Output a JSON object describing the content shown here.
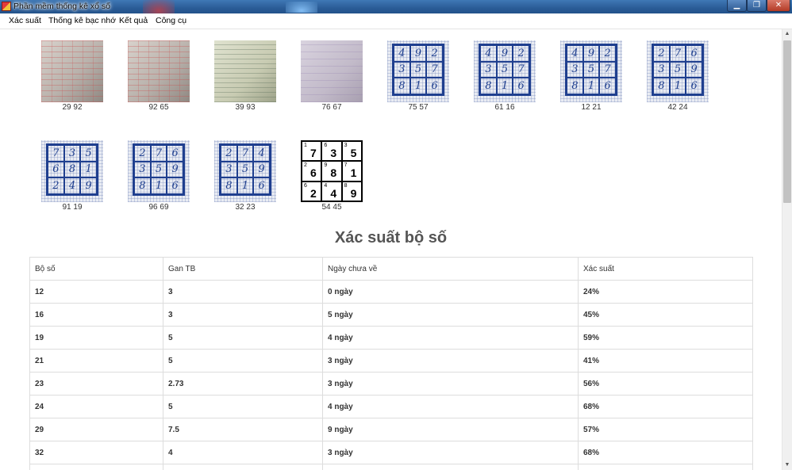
{
  "window": {
    "title": "Phần mềm thống kê xổ số"
  },
  "menu": [
    "Xác suất",
    "Thống kê bạc nhớ",
    "Kết quả",
    "Công cụ"
  ],
  "gallery": [
    {
      "caption": "29 92",
      "style": "photo-red"
    },
    {
      "caption": "92 65",
      "style": "photo-red"
    },
    {
      "caption": "39 93",
      "style": "photo-green"
    },
    {
      "caption": "76 67",
      "style": "photo-violet"
    },
    {
      "caption": "75 57",
      "style": "hand",
      "cells": [
        "4",
        "9",
        "2",
        "3",
        "5",
        "7",
        "8",
        "1",
        "6"
      ]
    },
    {
      "caption": "61 16",
      "style": "hand",
      "cells": [
        "4",
        "9",
        "2",
        "3",
        "5",
        "7",
        "8",
        "1",
        "6"
      ]
    },
    {
      "caption": "12 21",
      "style": "hand",
      "cells": [
        "4",
        "9",
        "2",
        "3",
        "5",
        "7",
        "8",
        "1",
        "6"
      ]
    },
    {
      "caption": "42 24",
      "style": "hand",
      "cells": [
        "2",
        "7",
        "6",
        "3",
        "5",
        "9",
        "8",
        "1",
        "6"
      ]
    },
    {
      "caption": "91 19",
      "style": "hand",
      "cells": [
        "7",
        "3",
        "5",
        "6",
        "8",
        "1",
        "2",
        "4",
        "9"
      ]
    },
    {
      "caption": "96 69",
      "style": "hand",
      "cells": [
        "2",
        "7",
        "6",
        "3",
        "5",
        "9",
        "8",
        "1",
        "6"
      ]
    },
    {
      "caption": "32 23",
      "style": "hand",
      "cells": [
        "2",
        "7",
        "4",
        "3",
        "5",
        "9",
        "8",
        "1",
        "6"
      ]
    },
    {
      "caption": "54 45",
      "style": "print",
      "cells": [
        {
          "sup": "1",
          "big": "7"
        },
        {
          "sup": "6",
          "big": "3"
        },
        {
          "sup": "3",
          "big": "5"
        },
        {
          "sup": "2",
          "big": "6"
        },
        {
          "sup": "9",
          "big": "8"
        },
        {
          "sup": "7",
          "big": "1"
        },
        {
          "sup": "6",
          "big": "2"
        },
        {
          "sup": "4",
          "big": "4"
        },
        {
          "sup": "8",
          "big": "9"
        }
      ]
    }
  ],
  "section": {
    "title": "Xác suất bộ số"
  },
  "table": {
    "headers": [
      "Bộ số",
      "Gan TB",
      "Ngày chưa về",
      "Xác suất"
    ],
    "rows": [
      [
        "12",
        "3",
        "0 ngày",
        "24%"
      ],
      [
        "16",
        "3",
        "5 ngày",
        "45%"
      ],
      [
        "19",
        "5",
        "4 ngày",
        "59%"
      ],
      [
        "21",
        "5",
        "3 ngày",
        "41%"
      ],
      [
        "23",
        "2.73",
        "3 ngày",
        "56%"
      ],
      [
        "24",
        "5",
        "4 ngày",
        "68%"
      ],
      [
        "29",
        "7.5",
        "9 ngày",
        "57%"
      ],
      [
        "32",
        "4",
        "3 ngày",
        "68%"
      ],
      [
        "",
        "",
        "",
        ""
      ]
    ]
  },
  "colors": {
    "titlebar": "#2a5c97",
    "heading": "#555555",
    "grid_ink": "#1f3f8f",
    "accent_pink": "#c43d6c"
  }
}
